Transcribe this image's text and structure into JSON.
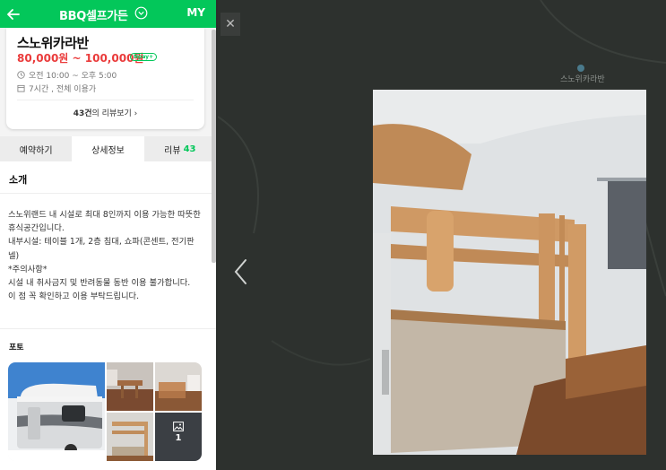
{
  "header": {
    "back_icon": "arrow-left-icon",
    "title": "BBQ셀프가든",
    "chevron_icon": "chevron-down-circle-icon",
    "my_label": "MY",
    "bg_color": "#03c75a"
  },
  "summary": {
    "name": "스노위카라반",
    "price": "80,000원 ~ 100,000원",
    "npay_badge": "Npay+",
    "hours": "오전 10:00 ~ 오후 5:00",
    "usage": "7시간 , 전체 이용가",
    "reviews_count": "43건",
    "reviews_suffix": "의 리뷰보기 ›",
    "price_color": "#ea3b3b"
  },
  "tabs": [
    {
      "label": "예약하기",
      "count": ""
    },
    {
      "label": "상세정보",
      "count": ""
    },
    {
      "label": "리뷰",
      "count": "43"
    }
  ],
  "intro": {
    "title": "소개",
    "lines": [
      "스노위랜드 내 시설로 최대 8인까지 이용 가능한 따뜻한 휴식공간입니다.",
      "내부시설: 테이블 1개, 2층 침대, 쇼파(콘센트, 전기판넬)",
      "*주의사항*",
      "시설 내 취사금지 및 반려동물 동반 이용 불가합니다.",
      "이 점 꼭 확인하고 이용 부탁드립니다."
    ]
  },
  "photos": {
    "title": "포토",
    "more_count": "1"
  },
  "viewer": {
    "close_icon": "close-icon",
    "prev_icon": "chevron-left-icon",
    "map_label": "스노위카라반"
  }
}
